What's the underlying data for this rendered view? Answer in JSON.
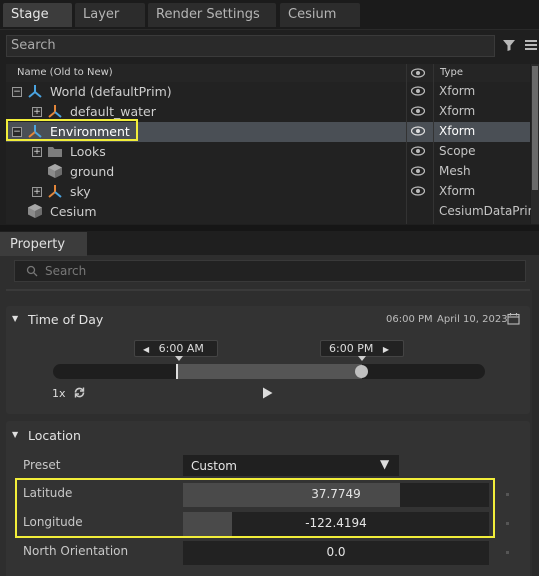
{
  "stage_tabs": [
    "Stage",
    "Layer",
    "Render Settings",
    "Cesium"
  ],
  "stage": {
    "search_placeholder": "Search",
    "col_name": "Name (Old to New)",
    "col_type": "Type",
    "rows": [
      {
        "name": "World (defaultPrim)",
        "type": "Xform",
        "icon": "xform-icon",
        "expander": "minus"
      },
      {
        "name": "default_water",
        "type": "Xform",
        "icon": "xform-icon",
        "expander": "plus"
      },
      {
        "name": "Environment",
        "type": "Xform",
        "icon": "xform-icon",
        "expander": "minus",
        "selected": true
      },
      {
        "name": "Looks",
        "type": "Scope",
        "icon": "folder-icon",
        "expander": "plus"
      },
      {
        "name": "ground",
        "type": "Mesh",
        "icon": "mesh-icon"
      },
      {
        "name": "sky",
        "type": "Xform",
        "icon": "xform-icon",
        "expander": "plus"
      },
      {
        "name": "Cesium",
        "type": "CesiumDataPrim",
        "icon": "cube-icon"
      }
    ]
  },
  "property": {
    "tab": "Property",
    "search_placeholder": "Search",
    "time_of_day": {
      "title": "Time of Day",
      "current_time": "06:00 PM",
      "date": "April 10, 2023",
      "start": "6:00  AM",
      "end": "6:00  PM",
      "speed": "1x"
    },
    "location": {
      "title": "Location",
      "preset_label": "Preset",
      "preset_value": "Custom",
      "latitude_label": "Latitude",
      "latitude_value": "37.7749",
      "longitude_label": "Longitude",
      "longitude_value": "-122.4194",
      "north_label": "North Orientation",
      "north_value": "0.0"
    }
  },
  "colors": {
    "highlight": "#f2ee3a",
    "xform_blue": "#4aa3df",
    "xform_orange": "#e3863a"
  }
}
